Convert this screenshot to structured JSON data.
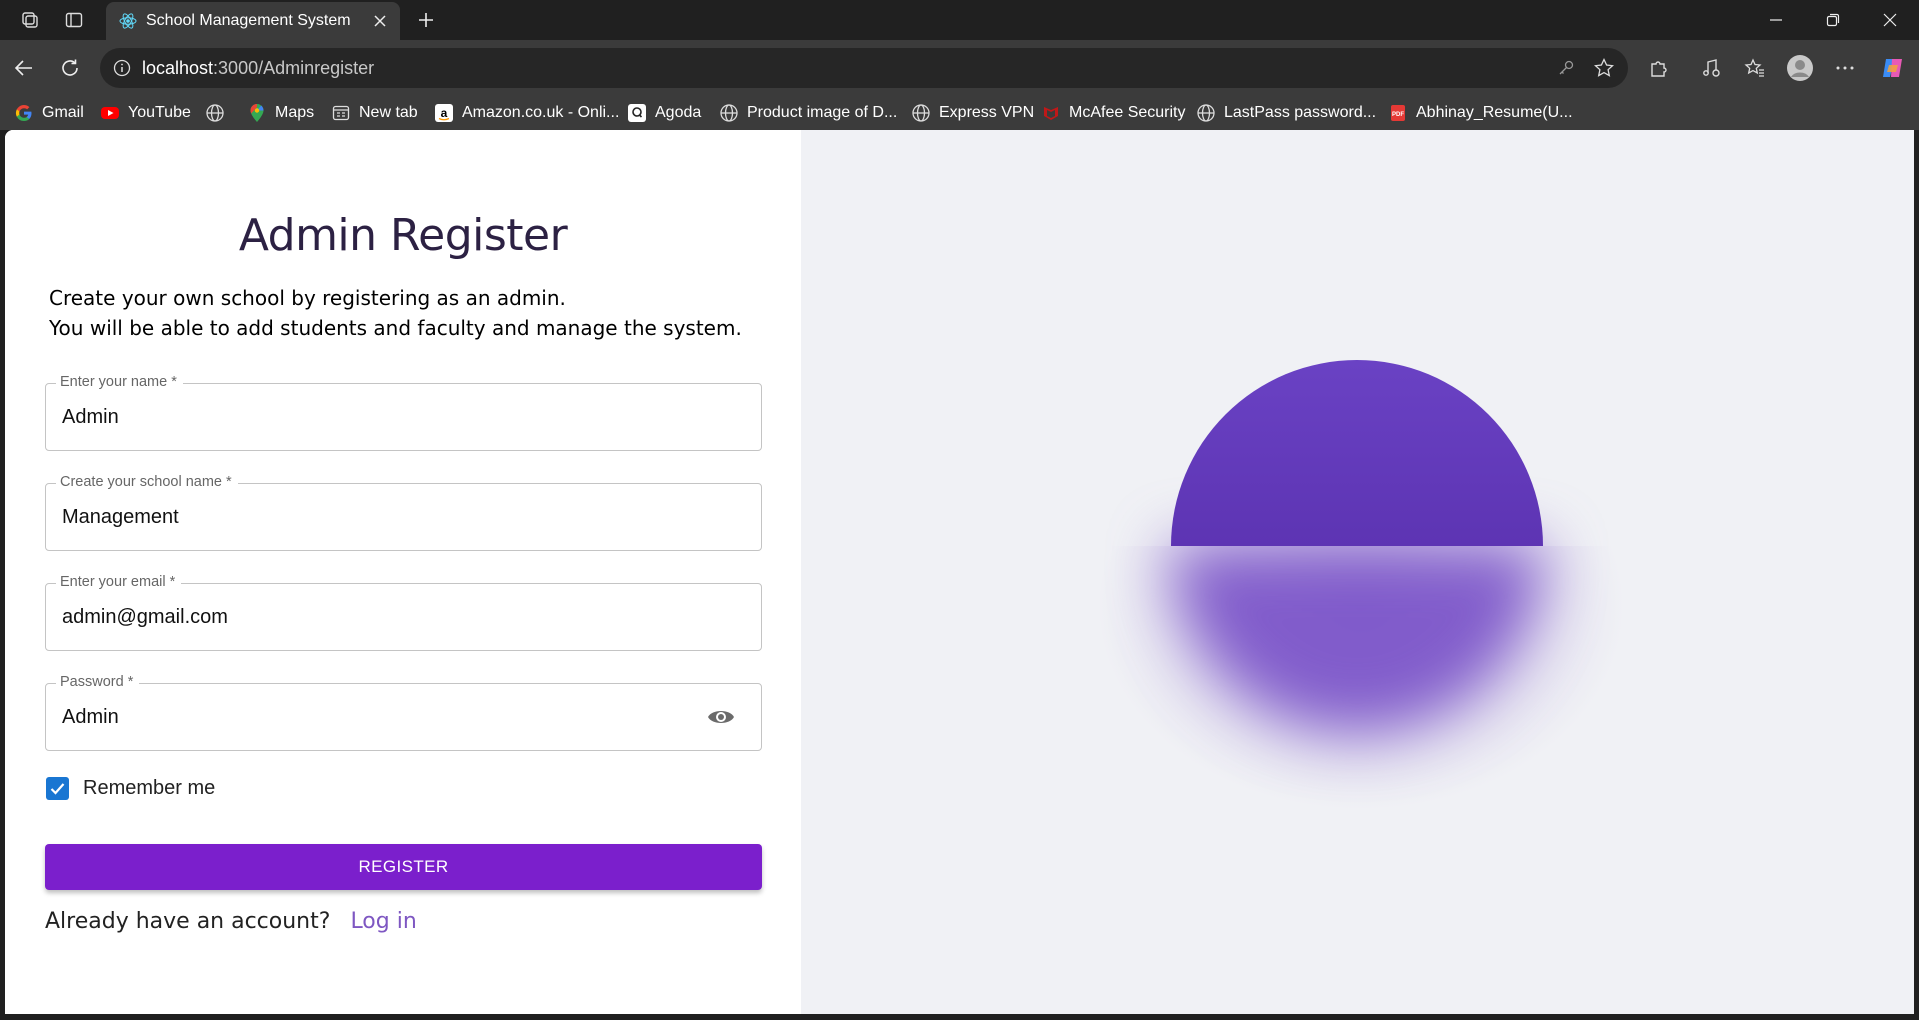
{
  "browser": {
    "tab_title": "School Management System",
    "url_host": "localhost",
    "url_path": ":3000/Adminregister",
    "bookmarks": [
      {
        "label": "Gmail",
        "icon": "google-icon"
      },
      {
        "label": "YouTube",
        "icon": "youtube-icon"
      },
      {
        "label": "",
        "icon": "globe-icon"
      },
      {
        "label": "Maps",
        "icon": "maps-icon"
      },
      {
        "label": "New tab",
        "icon": "newtab-icon"
      },
      {
        "label": "Amazon.co.uk - Onli...",
        "icon": "amazon-icon"
      },
      {
        "label": "Agoda",
        "icon": "agoda-icon"
      },
      {
        "label": "Product image of D...",
        "icon": "globe-icon"
      },
      {
        "label": "Express VPN",
        "icon": "globe-icon"
      },
      {
        "label": "McAfee Security",
        "icon": "mcafee-icon"
      },
      {
        "label": "LastPass password...",
        "icon": "globe-icon"
      },
      {
        "label": "Abhinay_Resume(U...",
        "icon": "pdf-icon"
      }
    ]
  },
  "form": {
    "title": "Admin Register",
    "subtitle_line1": "Create your own school by registering as an admin.",
    "subtitle_line2": "You will be able to add students and faculty and manage the system.",
    "name_label": "Enter your name *",
    "name_value": "Admin",
    "school_label": "Create your school name *",
    "school_value": "Management",
    "email_label": "Enter your email *",
    "email_value": "admin@gmail.com",
    "password_label": "Password *",
    "password_value": "Admin",
    "remember_label": "Remember me",
    "remember_checked": true,
    "register_label": "REGISTER",
    "account_prompt": "Already have an account?",
    "login_label": "Log in"
  },
  "colors": {
    "accent": "#7b1fcc",
    "checkbox": "#1976d2",
    "link": "#7e57c2",
    "title": "#2c2143",
    "sphere": "#6a42c4"
  }
}
